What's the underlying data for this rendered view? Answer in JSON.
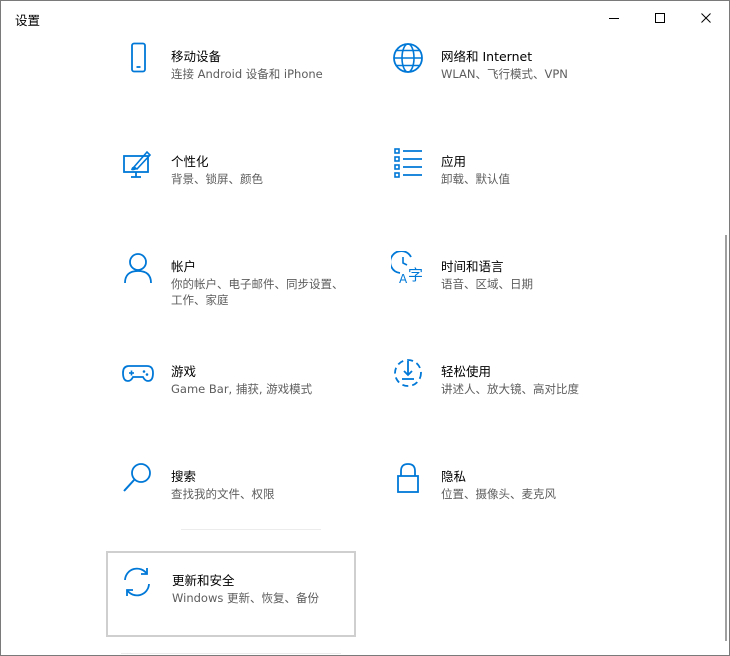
{
  "window": {
    "title": "设置"
  },
  "tiles": [
    {
      "name": "移动设备",
      "desc": "连接 Android 设备和 iPhone",
      "icon": "phone-icon"
    },
    {
      "name": "网络和 Internet",
      "desc": "WLAN、飞行模式、VPN",
      "icon": "globe-icon"
    },
    {
      "name": "个性化",
      "desc": "背景、锁屏、颜色",
      "icon": "personalization-icon"
    },
    {
      "name": "应用",
      "desc": "卸载、默认值",
      "icon": "apps-list-icon"
    },
    {
      "name": "帐户",
      "desc": "你的帐户、电子邮件、同步设置、工作、家庭",
      "icon": "person-icon"
    },
    {
      "name": "时间和语言",
      "desc": "语音、区域、日期",
      "icon": "time-language-icon"
    },
    {
      "name": "游戏",
      "desc": "Game Bar, 捕获, 游戏模式",
      "icon": "gamepad-icon"
    },
    {
      "name": "轻松使用",
      "desc": "讲述人、放大镜、高对比度",
      "icon": "ease-of-access-icon"
    },
    {
      "name": "搜索",
      "desc": "查找我的文件、权限",
      "icon": "search-icon"
    },
    {
      "name": "隐私",
      "desc": "位置、摄像头、麦克风",
      "icon": "lock-icon"
    },
    {
      "name": "更新和安全",
      "desc": "Windows 更新、恢复、备份",
      "icon": "sync-icon"
    }
  ],
  "colors": {
    "accent": "#0078d7",
    "text": "#000000",
    "subtext": "#5d5d5d"
  }
}
